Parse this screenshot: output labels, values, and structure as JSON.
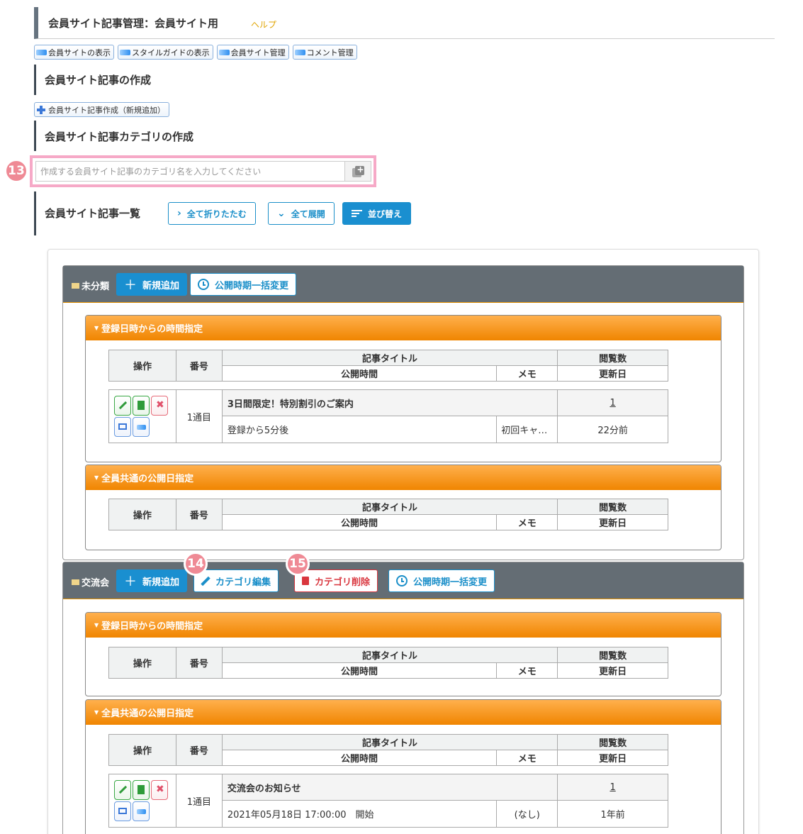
{
  "header": {
    "title": "会員サイト記事管理：会員サイト用",
    "help": "ヘルプ"
  },
  "link_buttons": [
    "会員サイトの表示",
    "スタイルガイドの表示",
    "会員サイト管理",
    "コメント管理"
  ],
  "section_create": {
    "title": "会員サイト記事の作成",
    "add_button": "会員サイト記事作成（新規追加）"
  },
  "section_category": {
    "title": "会員サイト記事カテゴリの作成",
    "input_placeholder": "作成する会員サイト記事のカテゴリ名を入力してください"
  },
  "section_list": {
    "title": "会員サイト記事一覧",
    "collapse_all": "全て折りたたむ",
    "expand_all": "全て展開",
    "sort": "並び替え"
  },
  "badges": [
    "13",
    "14",
    "15"
  ],
  "table_headers": {
    "ops": "操作",
    "number": "番号",
    "title": "記事タイトル",
    "views": "閲覧数",
    "pub_time": "公開時間",
    "memo": "メモ",
    "updated": "更新日"
  },
  "categories": [
    {
      "name": "未分類",
      "add_button": "新規追加",
      "bulk_button": "公開時期一括変更",
      "groups": [
        {
          "heading": "登録日時からの時間指定",
          "articles": [
            {
              "number": "1通目",
              "title": "3日間限定！特別割引のご案内",
              "views": "1",
              "pub_time": "登録から5分後",
              "memo": "初回キャ…",
              "updated": "22分前"
            }
          ]
        },
        {
          "heading": "全員共通の公開日指定",
          "articles": []
        }
      ]
    },
    {
      "name": "交流会",
      "add_button": "新規追加",
      "edit_button": "カテゴリ編集",
      "delete_button": "カテゴリ削除",
      "bulk_button": "公開時期一括変更",
      "groups": [
        {
          "heading": "登録日時からの時間指定",
          "articles": []
        },
        {
          "heading": "全員共通の公開日指定",
          "articles": [
            {
              "number": "1通目",
              "title": "交流会のお知らせ",
              "views": "1",
              "pub_time": "2021年05月18日 17:00:00　開始",
              "memo": "(なし)",
              "updated": "1年前"
            }
          ]
        }
      ]
    }
  ],
  "colors": {
    "accent": "#1a8fd0",
    "category_header": "#646d74",
    "group_header": "#f08500",
    "badge": "#ef8a95",
    "highlight": "#f6a9c7"
  }
}
